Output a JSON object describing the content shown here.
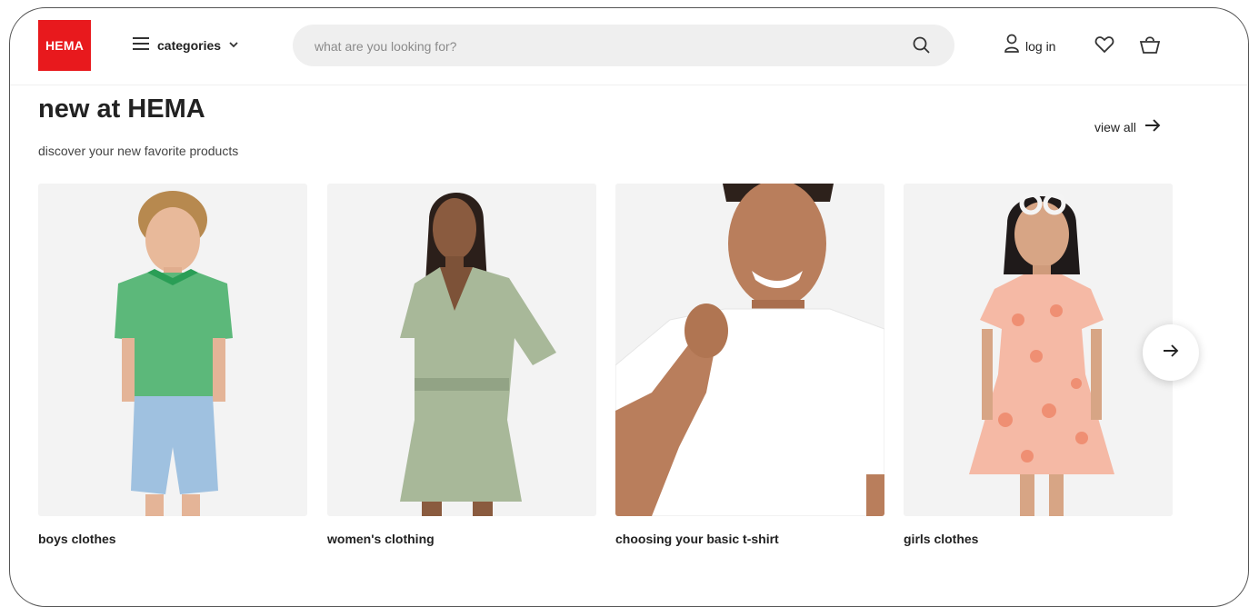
{
  "header": {
    "logo_text": "HEMA",
    "categories_label": "categories",
    "search_placeholder": "what are you looking for?",
    "login_label": "log in",
    "icons": [
      "menu-icon",
      "chevron-down-icon",
      "search-icon",
      "user-icon",
      "heart-icon",
      "basket-icon"
    ]
  },
  "section": {
    "title": "new at HEMA",
    "subtitle": "discover your new favorite products",
    "view_all_label": "view all"
  },
  "products": [
    {
      "label": "boys clothes"
    },
    {
      "label": "women's clothing"
    },
    {
      "label": "choosing your basic t-shirt"
    },
    {
      "label": "girls clothes"
    }
  ],
  "carousel": {
    "next_icon": "arrow-right-icon"
  },
  "colors": {
    "brand": "#e8191d",
    "search_bg": "#efefef",
    "card_bg": "#f3f3f3"
  }
}
